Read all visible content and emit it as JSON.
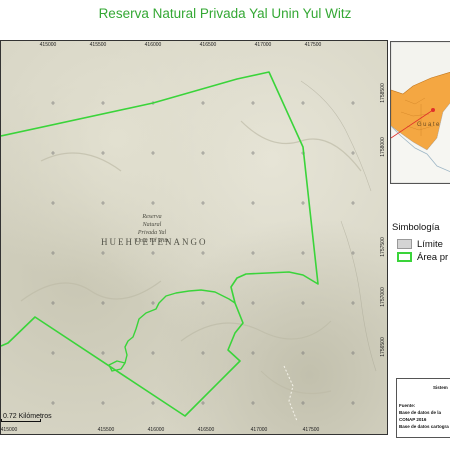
{
  "title": "Reserva Natural Privada Yal Unin Yul Witz",
  "map": {
    "x_ticks_top": [
      "415000",
      "415500",
      "416000",
      "416500",
      "417000",
      "417500"
    ],
    "x_ticks_bottom": [
      "415000",
      "415500",
      "416000",
      "416500",
      "417000",
      "417500"
    ],
    "y_ticks_right": [
      "1758500",
      "1758000",
      "1757500",
      "1757000",
      "1756500"
    ],
    "area_label": [
      "Reserva",
      "Natural",
      "Privada Yal",
      "Unin Yul Witz"
    ],
    "department_label": "HUEHUETENANGO",
    "scale_label": "0.72 Kilómetros",
    "boundary_color": "#3ad43a"
  },
  "inset": {
    "country_label": "Guate",
    "country_color": "#f4a742"
  },
  "legend": {
    "title": "Simbología",
    "items": [
      {
        "label": "Límite",
        "kind": "limit"
      },
      {
        "label": "Área pr",
        "kind": "area"
      }
    ]
  },
  "source": {
    "heading": "Sistem",
    "fuente_label": "Fuente:",
    "lines": [
      "Base de datos de la",
      "CONAP 2016",
      "Base de datos cartogra"
    ]
  }
}
